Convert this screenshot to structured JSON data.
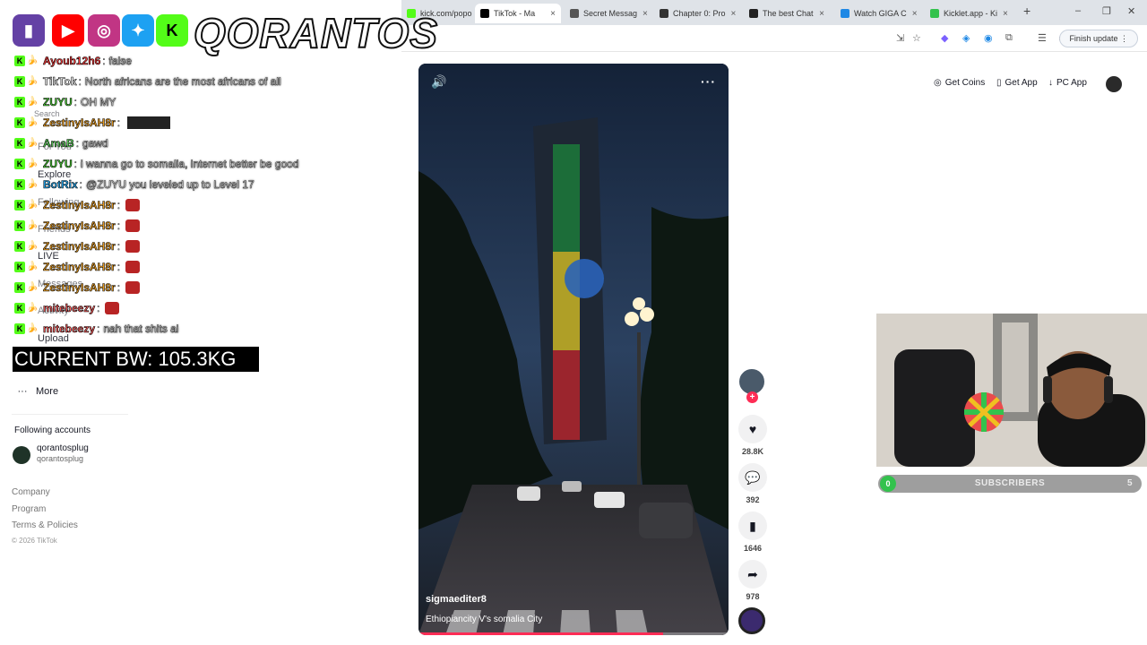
{
  "browser": {
    "tabs": [
      {
        "label": "kick.com/popo",
        "fav": "#53fc18",
        "active": false
      },
      {
        "label": "TikTok - Ma",
        "fav": "#000000",
        "active": true
      },
      {
        "label": "Secret Messag",
        "fav": "#555555",
        "active": false
      },
      {
        "label": "Chapter 0: Pro",
        "fav": "#333333",
        "active": false
      },
      {
        "label": "The best Chat",
        "fav": "#222222",
        "active": false
      },
      {
        "label": "Watch GIGA C",
        "fav": "#1e88e5",
        "active": false
      },
      {
        "label": "Kicklet.app - Ki",
        "fav": "#33c24d",
        "active": false
      }
    ],
    "finish_update": "Finish update"
  },
  "overlay": {
    "brand": "QORANTOS",
    "bw_text": "CURRENT BW: 105.3KG"
  },
  "chat": [
    {
      "user": "Ayoub12h6",
      "color": "#ff3b3b",
      "msg": "false",
      "extra": ""
    },
    {
      "user": "TikTok",
      "color": "#ffffff",
      "msg": "North africans are the most africans of all",
      "extra": ""
    },
    {
      "user": "ZUYU",
      "color": "#4cd137",
      "msg": "OH MY",
      "extra": ""
    },
    {
      "user": "ZestinyIsAH8r",
      "color": "#f0a020",
      "msg": "",
      "extra": "image"
    },
    {
      "user": "AmaB",
      "color": "#5bd65b",
      "msg": "gawd",
      "extra": ""
    },
    {
      "user": "ZUYU",
      "color": "#4cd137",
      "msg": "i wanna go to somalia, internet better be good",
      "extra": ""
    },
    {
      "user": "BotRix",
      "color": "#22a7f0",
      "msg": "@ZUYU you leveled up to Level 17",
      "extra": ""
    },
    {
      "user": "ZestinyIsAH8r",
      "color": "#f0a020",
      "msg": "",
      "extra": "red"
    },
    {
      "user": "ZestinyIsAH8r",
      "color": "#f0a020",
      "msg": "",
      "extra": "red"
    },
    {
      "user": "ZestinyIsAH8r",
      "color": "#f0a020",
      "msg": "",
      "extra": "red"
    },
    {
      "user": "ZestinyIsAH8r",
      "color": "#f0a020",
      "msg": "",
      "extra": "red"
    },
    {
      "user": "ZestinyIsAH8r",
      "color": "#f0a020",
      "msg": "",
      "extra": "red"
    },
    {
      "user": "mitebeezy",
      "color": "#ff5e5e",
      "msg": "",
      "extra": "red"
    },
    {
      "user": "mitebeezy",
      "color": "#ff5e5e",
      "msg": "nah that shits ai",
      "extra": ""
    }
  ],
  "sidebar": {
    "search": "Search",
    "for_you": "For You",
    "explore": "Explore",
    "following": "Following",
    "friends": "Friends",
    "live": "LIVE",
    "messages": "Messages",
    "activity": "Activity",
    "upload": "Upload",
    "more": "More",
    "following_accounts": "Following accounts",
    "account_name": "qorantosplug",
    "account_handle": "qorantosplug",
    "footer": [
      "Company",
      "Program",
      "Terms & Policies"
    ],
    "copyright": "© 2026 TikTok"
  },
  "header": {
    "get_coins": "Get Coins",
    "get_app": "Get App",
    "pc_app": "PC App"
  },
  "video": {
    "username": "sigmaediter8",
    "caption": "Ethiopiancity V's somalia City",
    "progress": 0.79
  },
  "actions": {
    "likes": "28.8K",
    "comments": "392",
    "saves": "1646",
    "shares": "978"
  },
  "subscribers": {
    "current": "0",
    "label": "SUBSCRIBERS",
    "goal": "5"
  }
}
